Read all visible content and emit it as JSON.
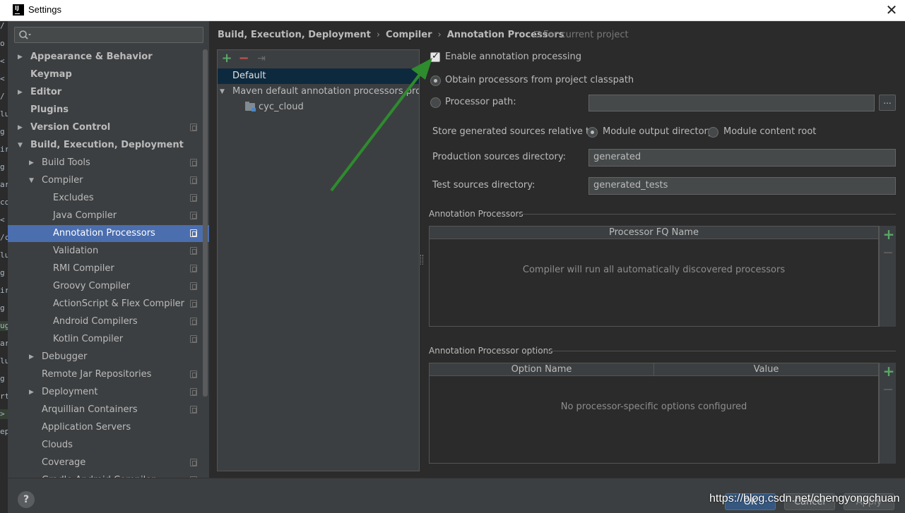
{
  "window": {
    "title": "Settings",
    "app_icon_text": "IJ",
    "close_symbol": "✕"
  },
  "editor_strip": [
    "/",
    "o",
    "<",
    "<",
    "/",
    "lu",
    "g",
    "ir",
    "g",
    "ar",
    "co",
    "<",
    "/c",
    "lu",
    "g",
    "ir",
    "g",
    "ug",
    "ar",
    "lu",
    "g",
    "rt",
    ">",
    "ep"
  ],
  "search": {
    "placeholder": "",
    "value": ""
  },
  "sidebar": {
    "items": [
      {
        "label": "Appearance & Behavior",
        "level": 0,
        "bold": true,
        "arrow": "right",
        "project": false
      },
      {
        "label": "Keymap",
        "level": 0,
        "bold": true,
        "arrow": "",
        "project": false
      },
      {
        "label": "Editor",
        "level": 0,
        "bold": true,
        "arrow": "right",
        "project": false
      },
      {
        "label": "Plugins",
        "level": 0,
        "bold": true,
        "arrow": "",
        "project": false
      },
      {
        "label": "Version Control",
        "level": 0,
        "bold": true,
        "arrow": "right",
        "project": true
      },
      {
        "label": "Build, Execution, Deployment",
        "level": 0,
        "bold": true,
        "arrow": "down",
        "project": false
      },
      {
        "label": "Build Tools",
        "level": 1,
        "bold": false,
        "arrow": "right",
        "project": true
      },
      {
        "label": "Compiler",
        "level": 1,
        "bold": false,
        "arrow": "down",
        "project": true
      },
      {
        "label": "Excludes",
        "level": 2,
        "bold": false,
        "arrow": "",
        "project": true
      },
      {
        "label": "Java Compiler",
        "level": 2,
        "bold": false,
        "arrow": "",
        "project": true
      },
      {
        "label": "Annotation Processors",
        "level": 2,
        "bold": false,
        "arrow": "",
        "project": true,
        "selected": true
      },
      {
        "label": "Validation",
        "level": 2,
        "bold": false,
        "arrow": "",
        "project": true
      },
      {
        "label": "RMI Compiler",
        "level": 2,
        "bold": false,
        "arrow": "",
        "project": true
      },
      {
        "label": "Groovy Compiler",
        "level": 2,
        "bold": false,
        "arrow": "",
        "project": true
      },
      {
        "label": "ActionScript & Flex Compiler",
        "level": 2,
        "bold": false,
        "arrow": "",
        "project": true
      },
      {
        "label": "Android Compilers",
        "level": 2,
        "bold": false,
        "arrow": "",
        "project": true
      },
      {
        "label": "Kotlin Compiler",
        "level": 2,
        "bold": false,
        "arrow": "",
        "project": true
      },
      {
        "label": "Debugger",
        "level": 1,
        "bold": false,
        "arrow": "right",
        "project": false
      },
      {
        "label": "Remote Jar Repositories",
        "level": 1,
        "bold": false,
        "arrow": "",
        "project": true
      },
      {
        "label": "Deployment",
        "level": 1,
        "bold": false,
        "arrow": "right",
        "project": true
      },
      {
        "label": "Arquillian Containers",
        "level": 1,
        "bold": false,
        "arrow": "",
        "project": true
      },
      {
        "label": "Application Servers",
        "level": 1,
        "bold": false,
        "arrow": "",
        "project": false
      },
      {
        "label": "Clouds",
        "level": 1,
        "bold": false,
        "arrow": "",
        "project": false
      },
      {
        "label": "Coverage",
        "level": 1,
        "bold": false,
        "arrow": "",
        "project": true
      },
      {
        "label": "Gradle-Android Compiler",
        "level": 1,
        "bold": false,
        "arrow": "",
        "project": true
      }
    ]
  },
  "breadcrumb": {
    "items": [
      "Build, Execution, Deployment",
      "Compiler",
      "Annotation Processors"
    ],
    "separator": "›",
    "scope": "For current project"
  },
  "profiles": {
    "add_symbol": "+",
    "remove_symbol": "−",
    "move_symbol": "⇥",
    "default_label": "Default",
    "maven_label": "Maven default annotation processors profile",
    "module_label": "cyc_cloud"
  },
  "settings": {
    "enable_label": "Enable annotation processing",
    "enable_checked": true,
    "obtain_classpath_label": "Obtain processors from project classpath",
    "processor_path_label": "Processor path:",
    "processor_path_value": "",
    "browse_label": "...",
    "store_label": "Store generated sources relative to:",
    "module_output_label": "Module output directory",
    "module_content_label": "Module content root",
    "production_label": "Production sources directory:",
    "production_value": "generated",
    "test_label": "Test sources directory:",
    "test_value": "generated_tests"
  },
  "processors_table": {
    "section_title": "Annotation Processors",
    "header": "Processor FQ Name",
    "empty_text": "Compiler will run all automatically discovered processors"
  },
  "options_table": {
    "section_title": "Annotation Processor options",
    "headers": [
      "Option Name",
      "Value"
    ],
    "empty_text": "No processor-specific options configured"
  },
  "footer": {
    "help_label": "?",
    "ok_label": "OK",
    "cancel_label": "Cancel",
    "apply_label": "Apply"
  },
  "watermark": "https://blog.csdn.net/chengyongchuan",
  "colors": {
    "accent_selection": "#4b6eaf",
    "add_green": "#59a869",
    "remove_red": "#c75450",
    "annotation_arrow": "#2e8b2e"
  }
}
